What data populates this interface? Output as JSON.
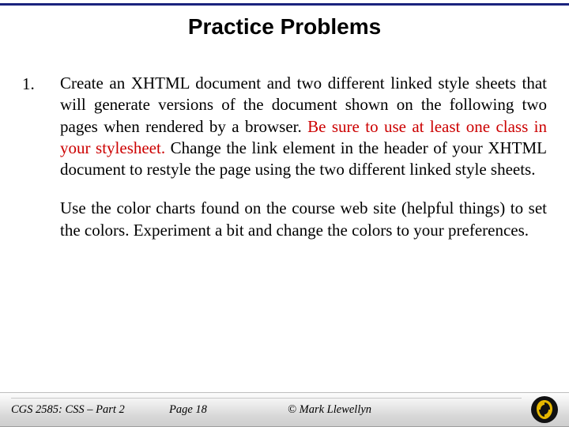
{
  "title": "Practice Problems",
  "item": {
    "number": "1.",
    "para1_a": "Create an XHTML document and two different linked style sheets that will generate versions of the document shown on the following two pages when rendered by a browser.  ",
    "para1_red": "Be sure to use at least one class in your stylesheet.",
    "para1_b": "  Change the link element in the header of your XHTML document to restyle the page using the two different linked style sheets.",
    "para2": "Use the color charts found on the course web site (helpful things) to set the colors.  Experiment a bit and change the colors to your preferences."
  },
  "footer": {
    "course": "CGS 2585: CSS – Part 2",
    "page": "Page 18",
    "copyright": "© Mark Llewellyn"
  },
  "logo_name": "ucf-pegasus-logo"
}
